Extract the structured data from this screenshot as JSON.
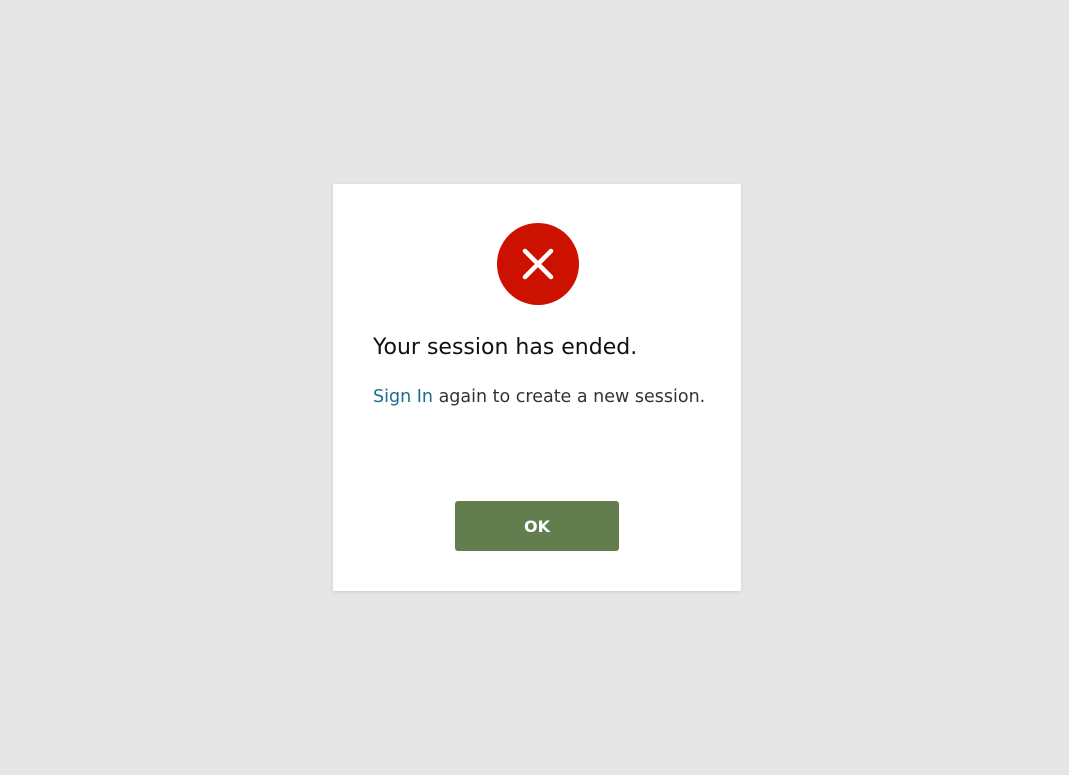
{
  "dialog": {
    "icon": "error-x-circle-icon",
    "icon_color": "#cc1100",
    "title": "Your session has ended.",
    "message": {
      "link_text": "Sign In",
      "rest_text": " again to create a new session."
    },
    "ok_label": "OK"
  },
  "colors": {
    "page_background": "#e6e6e6",
    "link": "#1a6e8a",
    "button": "#627e4f"
  }
}
